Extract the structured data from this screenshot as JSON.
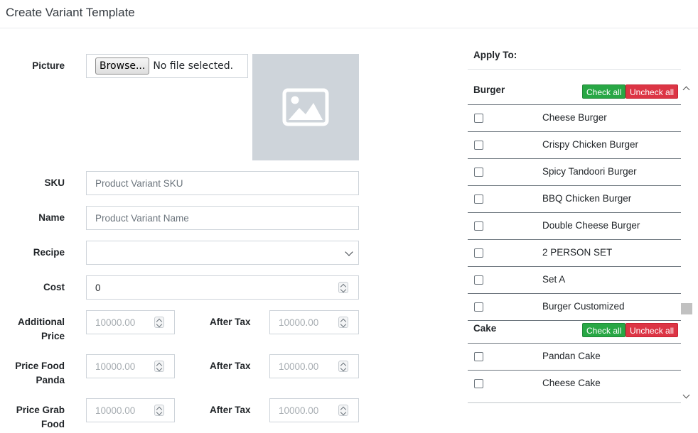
{
  "page": {
    "title": "Create Variant Template"
  },
  "form": {
    "picture": {
      "label": "Picture",
      "browse_label": "Browse...",
      "file_status": "No file selected."
    },
    "sku": {
      "label": "SKU",
      "placeholder": "Product Variant SKU"
    },
    "name": {
      "label": "Name",
      "placeholder": "Product Variant Name"
    },
    "recipe": {
      "label": "Recipe",
      "selected": ""
    },
    "cost": {
      "label": "Cost",
      "value": "0"
    },
    "additional_price": {
      "label_line1": "Additional",
      "label_line2": "Price",
      "value": "10000.00",
      "after_tax_label": "After Tax",
      "after_tax_value": "10000.00"
    },
    "price_food_panda": {
      "label_line1": "Price Food",
      "label_line2": "Panda",
      "value": "10000.00",
      "after_tax_label": "After Tax",
      "after_tax_value": "10000.00"
    },
    "price_grab_food": {
      "label_line1": "Price Grab",
      "label_line2": "Food",
      "value": "10000.00",
      "after_tax_label": "After Tax",
      "after_tax_value": "10000.00"
    }
  },
  "apply_to": {
    "title": "Apply To:",
    "groups": [
      {
        "name": "Burger",
        "check_all_label": "Check all",
        "uncheck_all_label": "Uncheck all",
        "items": [
          {
            "name": "Cheese Burger",
            "checked": false
          },
          {
            "name": "Crispy Chicken Burger",
            "checked": false
          },
          {
            "name": "Spicy Tandoori Burger",
            "checked": false
          },
          {
            "name": "BBQ Chicken Burger",
            "checked": false
          },
          {
            "name": "Double Cheese Burger",
            "checked": false
          },
          {
            "name": "2 PERSON SET",
            "checked": false
          },
          {
            "name": "Set A",
            "checked": false
          },
          {
            "name": "Burger Customized",
            "checked": false
          }
        ]
      },
      {
        "name": "Cake",
        "check_all_label": "Check all",
        "uncheck_all_label": "Uncheck all",
        "items": [
          {
            "name": "Pandan Cake",
            "checked": false
          },
          {
            "name": "Cheese Cake",
            "checked": false
          }
        ]
      }
    ]
  },
  "colors": {
    "check_all": "#28a745",
    "uncheck_all": "#dc3545",
    "image_placeholder": "#ced4da"
  },
  "icons": {
    "image_placeholder": "image-icon",
    "recipe_dropdown": "chevron-down-icon",
    "number_spinner": "spinner-icon"
  }
}
